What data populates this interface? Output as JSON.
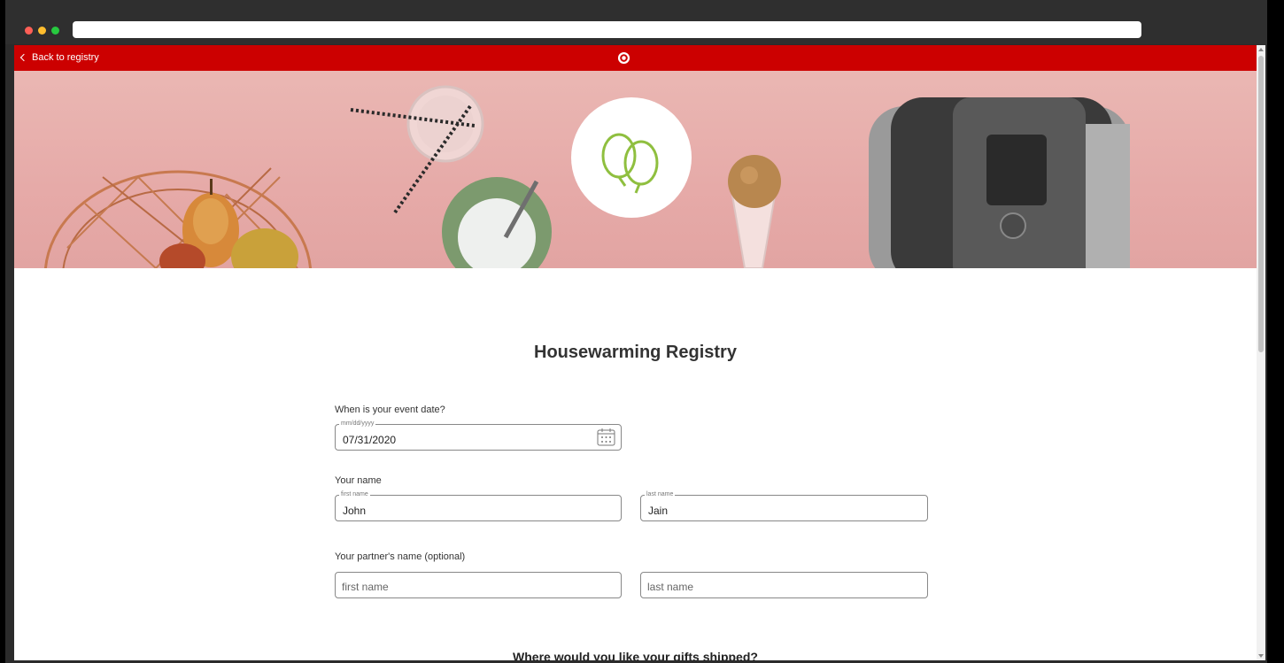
{
  "header": {
    "back_label": "Back to registry",
    "brand_color": "#cc0000",
    "logo_icon": "target-bullseye-icon"
  },
  "hero": {
    "badge_icon": "balloons-icon",
    "accent_color": "#8fbf3f"
  },
  "page": {
    "title": "Housewarming Registry"
  },
  "event_date": {
    "label": "When is your event date?",
    "legend": "mm/dd/yyyy",
    "value": "07/31/2020",
    "icon": "calendar-icon"
  },
  "your_name": {
    "label": "Your name",
    "first_legend": "first name",
    "first_value": "John",
    "last_legend": "last name",
    "last_value": "Jain"
  },
  "partner_name": {
    "label": "Your partner's name (optional)",
    "first_placeholder": "first name",
    "last_placeholder": "last name"
  },
  "shipping": {
    "heading": "Where would you like your gifts shipped?"
  }
}
